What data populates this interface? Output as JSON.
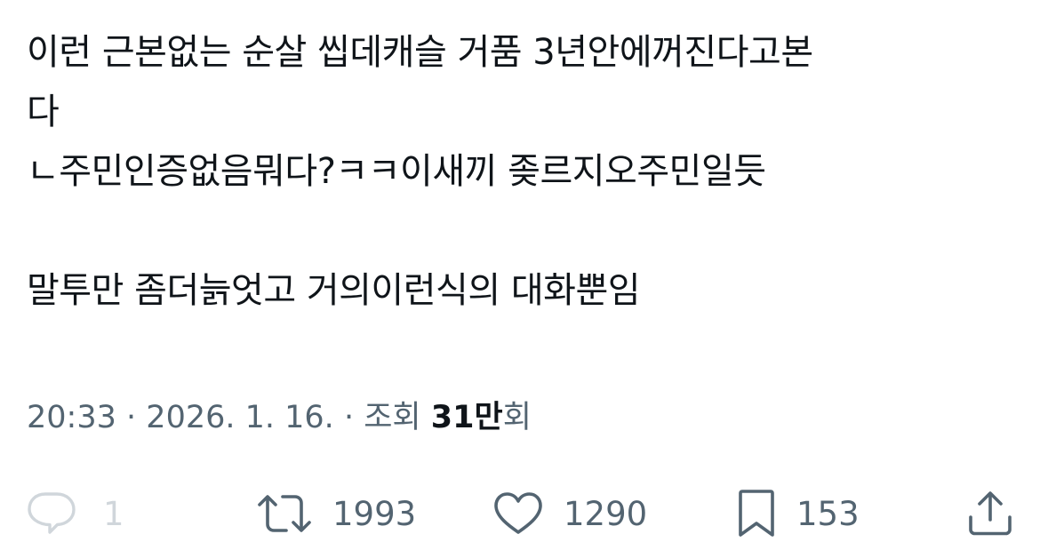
{
  "tweet": {
    "lines": [
      "이런 근본없는 순살 씹데캐슬 거품 3년안에꺼진다고본",
      "다",
      "ㄴ주민인증없음뭐다?ㅋㅋ이새끼 좆르지오주민일듯",
      "",
      "말투만 좀더늙엇고 거의이런식의 대화뿐임"
    ]
  },
  "meta": {
    "time": "20:33",
    "separator": "·",
    "date": "2026. 1. 16.",
    "views_prefix": "조회",
    "views_count": "31만",
    "views_suffix": "회"
  },
  "actions": {
    "reply": {
      "icon": "reply-icon",
      "count": "1"
    },
    "retweet": {
      "icon": "retweet-icon",
      "count": "1993"
    },
    "like": {
      "icon": "heart-icon",
      "count": "1290"
    },
    "bookmark": {
      "icon": "bookmark-icon",
      "count": "153"
    },
    "share": {
      "icon": "share-icon"
    }
  },
  "colors": {
    "text": "#0f1419",
    "secondary": "#536471",
    "reply_muted": "#d0d6db"
  }
}
